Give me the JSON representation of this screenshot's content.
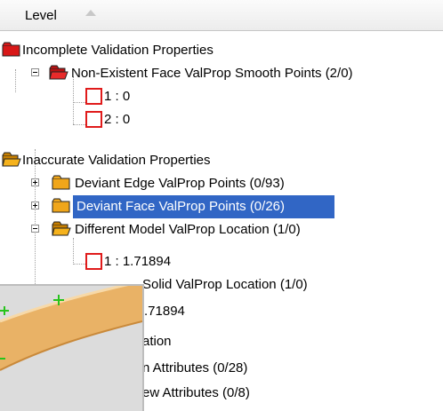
{
  "header": {
    "title": "Level"
  },
  "colors": {
    "red_folder": "#d81818",
    "orange_folder": "#f0a61a",
    "selection": "#3166c5",
    "box_border": "#e01b1b"
  },
  "tree": {
    "rows": [
      {
        "label": "Incomplete Validation Properties"
      },
      {
        "label": "Non-Existent Face ValProp Smooth Points (2/0)"
      },
      {
        "label": "1 : 0"
      },
      {
        "label": "2 : 0"
      },
      {
        "label": "Inaccurate Validation Properties"
      },
      {
        "label": "Deviant Edge ValProp Points (0/93)"
      },
      {
        "label": "Deviant Face ValProp Points (0/26)"
      },
      {
        "label": "Different Model ValProp Location (1/0)"
      },
      {
        "label": "1 : 1.71894"
      },
      {
        "label": "Solid ValProp Location (1/0)"
      },
      {
        "label": ".71894"
      },
      {
        "label": "ation"
      },
      {
        "label": "n Attributes (0/28)"
      },
      {
        "label": "ew Attributes (0/8)"
      }
    ]
  }
}
